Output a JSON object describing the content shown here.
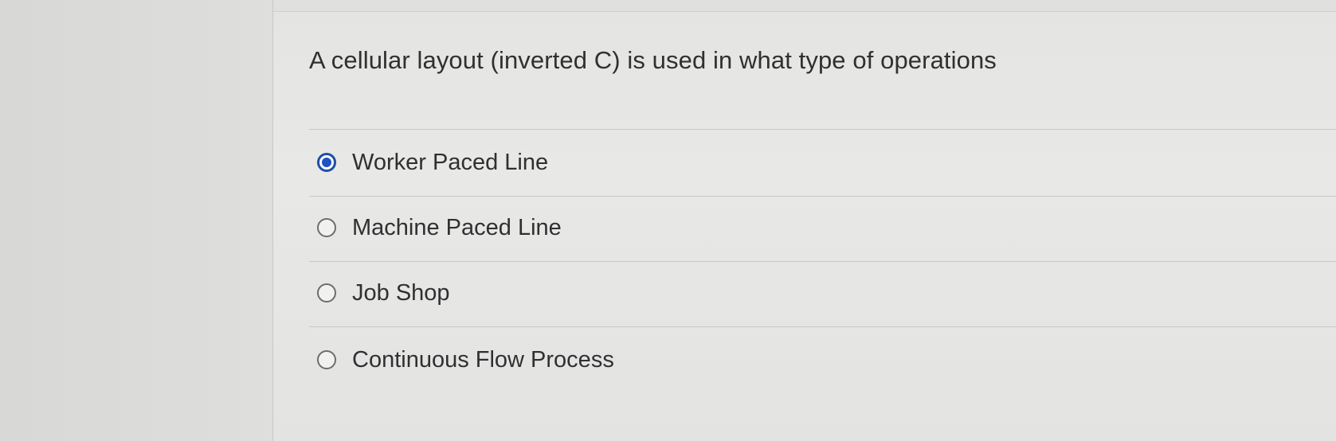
{
  "question": {
    "text": "A cellular layout (inverted C) is used in what type of operations"
  },
  "options": [
    {
      "label": "Worker Paced Line",
      "selected": true
    },
    {
      "label": "Machine Paced Line",
      "selected": false
    },
    {
      "label": "Job Shop",
      "selected": false
    },
    {
      "label": "Continuous Flow Process",
      "selected": false
    }
  ],
  "colors": {
    "selected_radio": "#1d52c4",
    "text": "#2f3032",
    "background": "#e4e4e2"
  }
}
